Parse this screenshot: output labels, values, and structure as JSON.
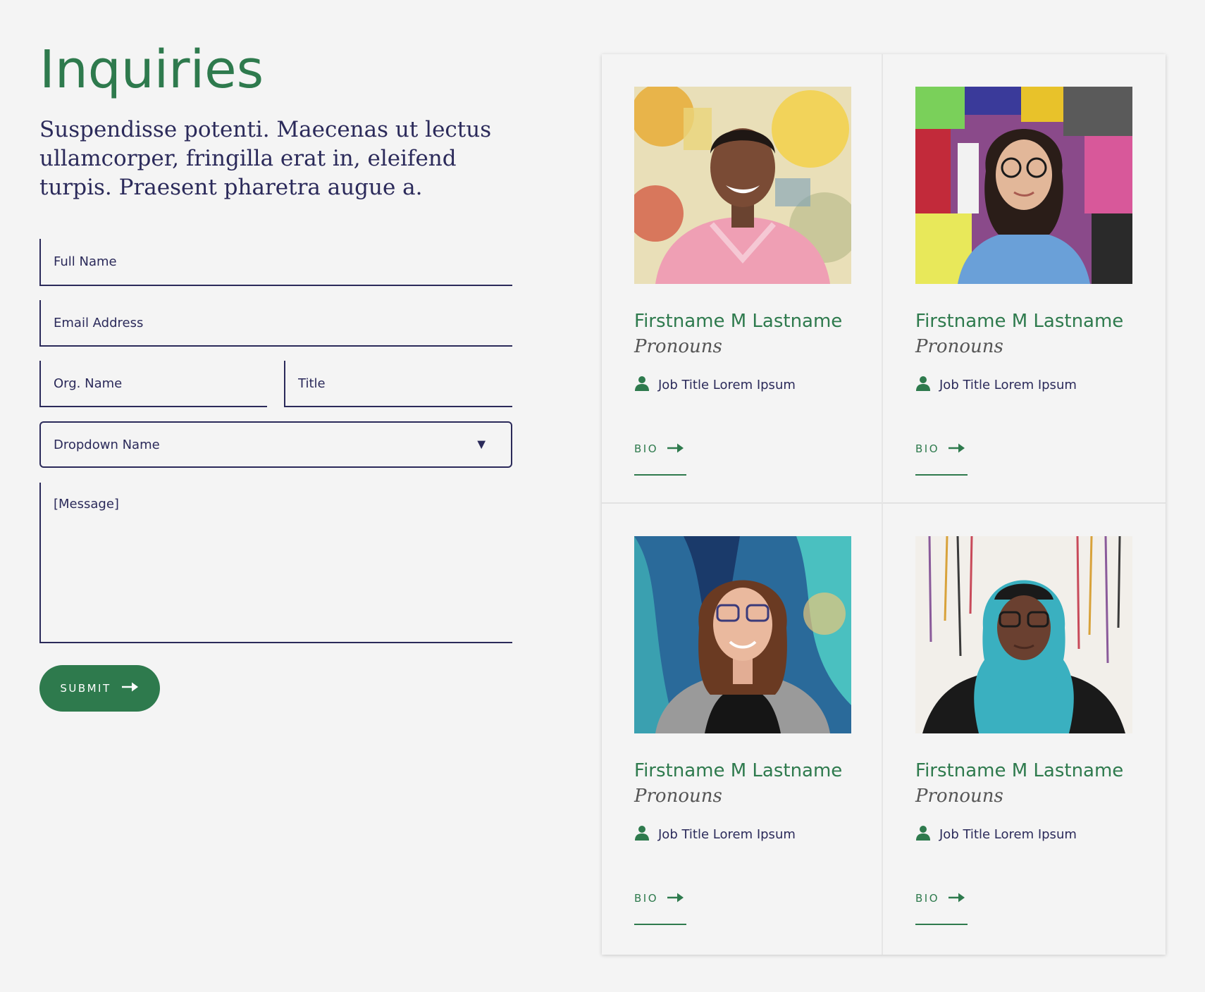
{
  "page": {
    "title": "Inquiries",
    "lead": "Suspendisse potenti. Maecenas ut lectus ullamcorper, fringilla erat in, eleifend turpis. Praesent pharetra augue a."
  },
  "form": {
    "full_name_placeholder": "Full Name",
    "email_placeholder": "Email Address",
    "org_placeholder": "Org. Name",
    "title_placeholder": "Title",
    "dropdown_label": "Dropdown Name",
    "message_placeholder": "[Message]",
    "submit_label": "SUBMIT"
  },
  "icons": {
    "dropdown": "chevron-down-icon",
    "submit": "arrow-right-icon",
    "job": "person-icon",
    "bio": "arrow-right-icon"
  },
  "colors": {
    "accent_green": "#2e7a4d",
    "ink_navy": "#2b2a5a",
    "background": "#f4f4f4"
  },
  "people": [
    {
      "name": "Firstname M Lastname",
      "pronouns": "Pronouns",
      "job": "Job Title Lorem Ipsum",
      "bio_label": "BIO"
    },
    {
      "name": "Firstname M Lastname",
      "pronouns": "Pronouns",
      "job": "Job Title Lorem Ipsum",
      "bio_label": "BIO"
    },
    {
      "name": "Firstname M Lastname",
      "pronouns": "Pronouns",
      "job": "Job Title Lorem Ipsum",
      "bio_label": "BIO"
    },
    {
      "name": "Firstname M Lastname",
      "pronouns": "Pronouns",
      "job": "Job Title Lorem Ipsum",
      "bio_label": "BIO"
    }
  ]
}
